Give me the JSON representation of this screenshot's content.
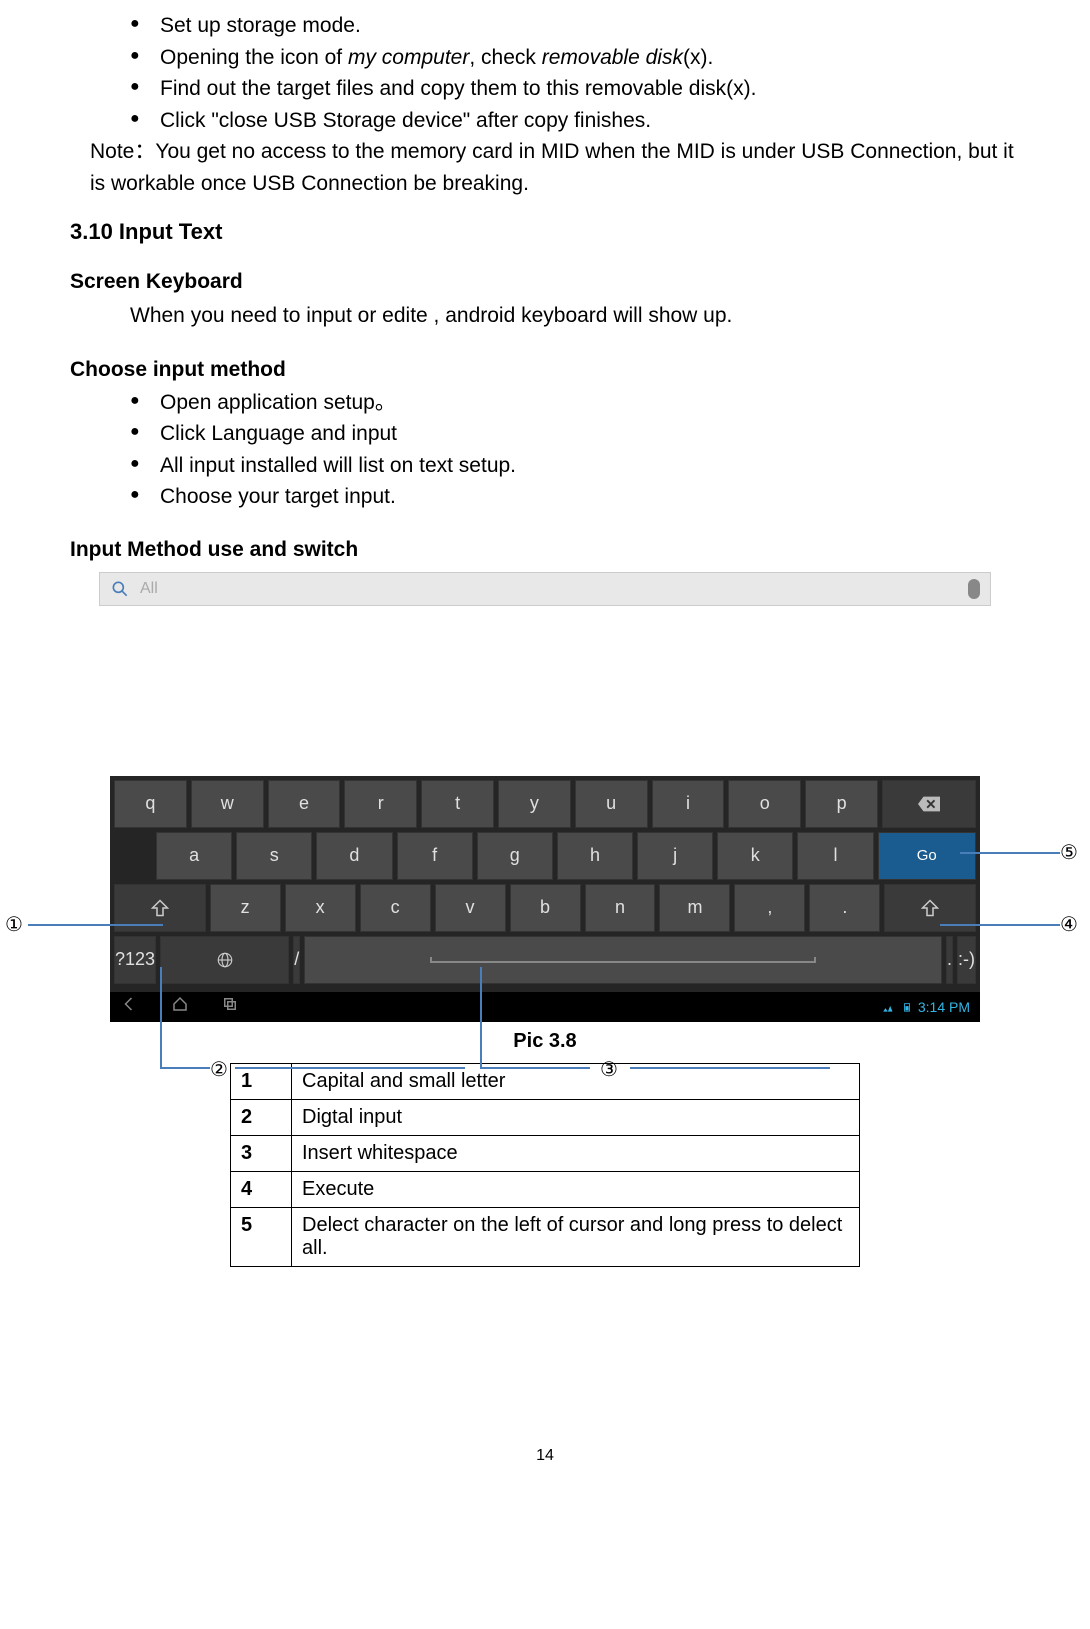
{
  "bullets_top": [
    "Set up storage mode.",
    "Opening the icon of my computer, check removable disk(x).",
    "Find out the target files and copy them to this removable disk(x).",
    " Click \"close USB Storage device\" after copy finishes."
  ],
  "note_label": "Note：",
  "note_text": "You get no access to the memory card in MID when the MID is under USB Connection, but it is workable once USB Connection be breaking.",
  "section_heading": "3.10 Input Text",
  "screen_kb_heading": "Screen Keyboard",
  "screen_kb_text": "When you need to input or edite , android keyboard will show up.",
  "choose_heading": "Choose input method",
  "bullets_choose": [
    "Open application setup。",
    "Click Language and input",
    "All input installed will list on text setup.",
    " Choose your target input."
  ],
  "switch_heading": "Input Method use and switch",
  "search_placeholder": "All",
  "kb_row1": [
    "q",
    "w",
    "e",
    "r",
    "t",
    "y",
    "u",
    "i",
    "o",
    "p"
  ],
  "kb_row2": [
    "a",
    "s",
    "d",
    "f",
    "g",
    "h",
    "j",
    "k",
    "l"
  ],
  "kb_go": "Go",
  "kb_row3_mid": [
    "z",
    "x",
    "c",
    "v",
    "b",
    "n",
    "m",
    ",",
    "."
  ],
  "kb_123": "?123",
  "kb_slash": "/",
  "kb_smiley": ":-)",
  "nav_time": "3:14 PM",
  "caption": "Pic 3.8",
  "callouts": {
    "c1": "①",
    "c2": "②",
    "c3": "③",
    "c4": "④",
    "c5": "⑤"
  },
  "legend": [
    {
      "n": "1",
      "t": "Capital and small letter"
    },
    {
      "n": "2",
      "t": "Digtal input"
    },
    {
      "n": "3",
      "t": "Insert whitespace"
    },
    {
      "n": "4",
      "t": "Execute"
    },
    {
      "n": "5",
      "t": "Delect character on the left of cursor and long press to delect all."
    }
  ],
  "page_number": "14"
}
